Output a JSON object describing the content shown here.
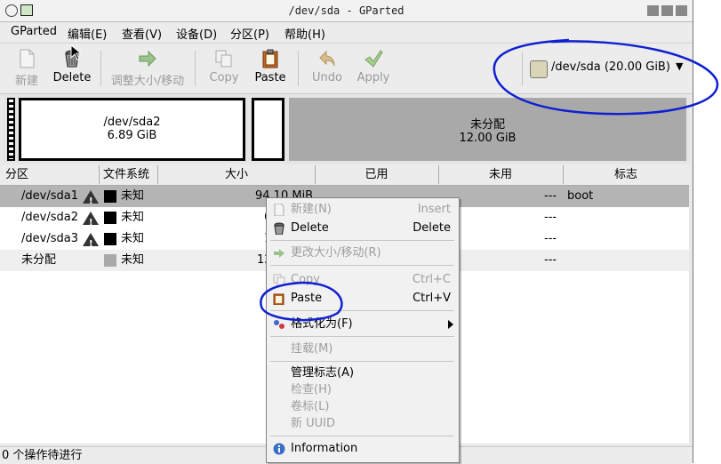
{
  "window": {
    "title": "/dev/sda - GParted"
  },
  "menubar": {
    "items": [
      "GParted",
      "编辑(E)",
      "查看(V)",
      "设备(D)",
      "分区(P)",
      "帮助(H)"
    ]
  },
  "toolbar": {
    "new_label": "新建",
    "delete_label": "Delete",
    "resize_label": "调整大小/移动",
    "copy_label": "Copy",
    "paste_label": "Paste",
    "undo_label": "Undo",
    "apply_label": "Apply",
    "device_label": "/dev/sda  (20.00 GiB)"
  },
  "partition_map": {
    "sda2_name": "/dev/sda2",
    "sda2_size": "6.89 GiB",
    "unalloc_name": "未分配",
    "unalloc_size": "12.00 GiB"
  },
  "table": {
    "columns": [
      "分区",
      "文件系统",
      "大小",
      "已用",
      "未用",
      "标志"
    ],
    "rows": [
      {
        "partition": "/dev/sda1",
        "filesystem": "未知",
        "size": "94.10 MiB",
        "used": "",
        "unused": "---",
        "flags": "boot"
      },
      {
        "partition": "/dev/sda2",
        "filesystem": "未知",
        "size": "6",
        "used": "",
        "unused": "---",
        "flags": ""
      },
      {
        "partition": "/dev/sda3",
        "filesystem": "未知",
        "size": "1",
        "used": "",
        "unused": "---",
        "flags": ""
      },
      {
        "partition": "未分配",
        "filesystem": "未知",
        "size": "12",
        "used": "",
        "unused": "---",
        "flags": ""
      }
    ]
  },
  "context_menu": {
    "new": {
      "label": "新建(N)",
      "accel": "Insert"
    },
    "delete": {
      "label": "Delete",
      "accel": "Delete"
    },
    "resize": {
      "label": "更改大小/移动(R)"
    },
    "copy": {
      "label": "Copy",
      "accel": "Ctrl+C"
    },
    "paste": {
      "label": "Paste",
      "accel": "Ctrl+V"
    },
    "format": {
      "label": "格式化为(F)"
    },
    "mount": {
      "label": "挂载(M)"
    },
    "manage_flags": {
      "label": "管理标志(A)"
    },
    "check": {
      "label": "检查(H)"
    },
    "label": {
      "label": "卷标(L)"
    },
    "new_uuid": {
      "label": "新 UUID"
    },
    "information": {
      "label": "Information"
    }
  },
  "statusbar": {
    "text": "0 个操作待进行"
  },
  "colors": {
    "annotation": "#1020d0",
    "selected_row": "#b4b4b4",
    "unallocated": "#a9a9a9"
  }
}
